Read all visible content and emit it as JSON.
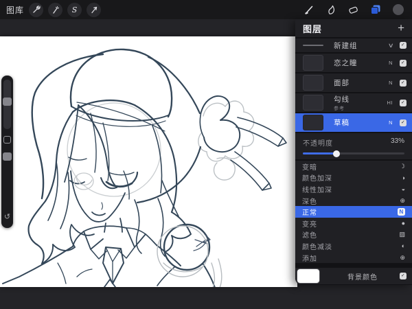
{
  "toolbar": {
    "gallery_label": "图库",
    "selection_letter": "S"
  },
  "layers_panel": {
    "title": "图层",
    "add_label": "+",
    "group": {
      "name": "新建组"
    },
    "layers": [
      {
        "name": "恋之瞳",
        "blend": "N"
      },
      {
        "name": "面部",
        "blend": "N"
      },
      {
        "name": "勾线",
        "sub": "参考",
        "blend": "HI"
      },
      {
        "name": "草稿",
        "blend": "N",
        "selected": true
      }
    ],
    "opacity": {
      "label": "不透明度",
      "value": "33%",
      "percent": 33
    },
    "blend_modes": [
      {
        "label": "变暗",
        "icon": "☽"
      },
      {
        "label": "颜色加深",
        "icon": "◑"
      },
      {
        "label": "线性加深",
        "icon": "◒"
      },
      {
        "label": "深色",
        "icon": "⊕"
      },
      {
        "label": "正常",
        "icon": "N",
        "selected": true
      },
      {
        "label": "变亮",
        "icon": "●"
      },
      {
        "label": "滤色",
        "icon": "▨"
      },
      {
        "label": "颜色减淡",
        "icon": "◐"
      },
      {
        "label": "添加",
        "icon": "⊕"
      }
    ],
    "background": {
      "label": "背景颜色",
      "color": "#ffffff"
    }
  },
  "colors": {
    "accent_blue": "#3a68e6",
    "canvas_line": "#37495c",
    "sketch_gray": "#c6cacd"
  }
}
